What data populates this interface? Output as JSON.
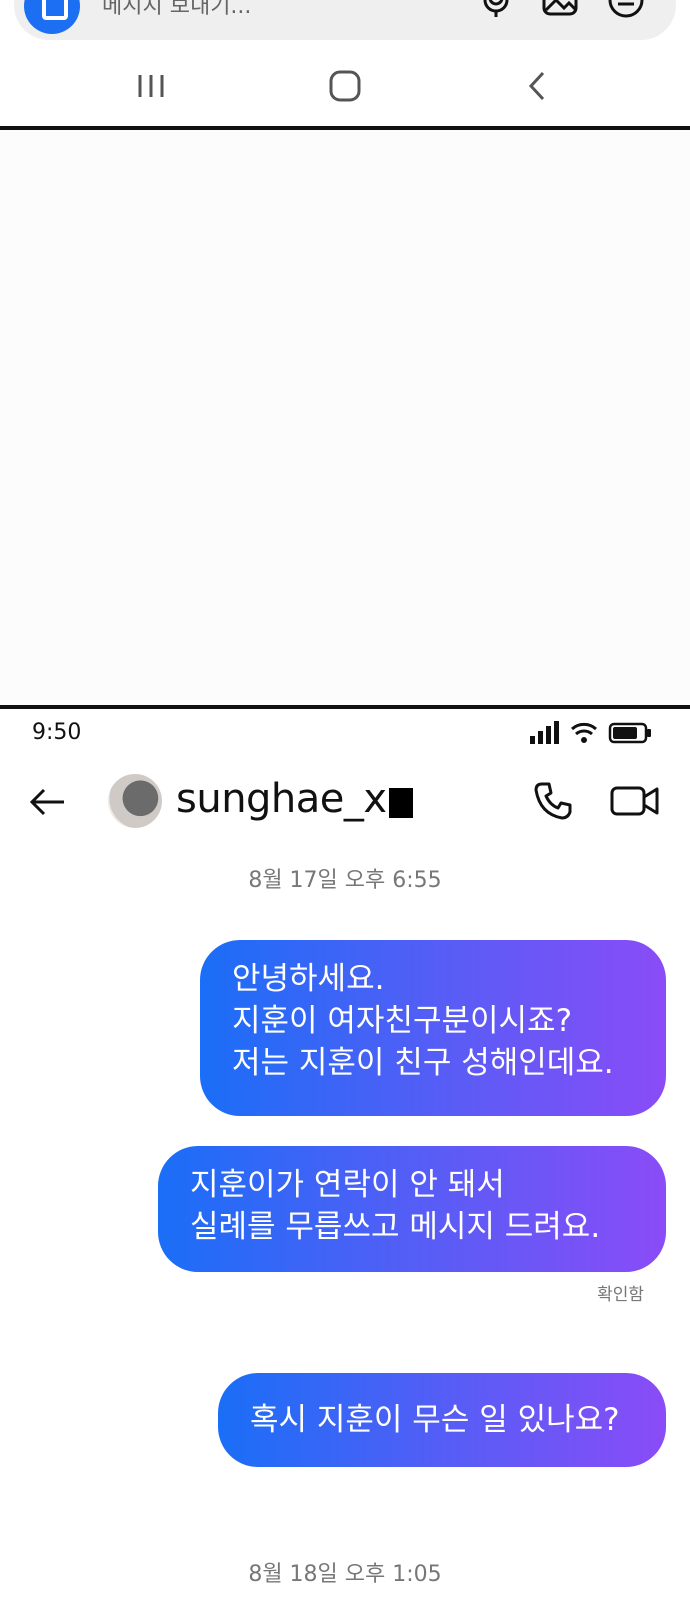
{
  "composer": {
    "placeholder": "메시지 보내기...",
    "icons": [
      "camera-icon",
      "microphone-icon",
      "gallery-icon",
      "sticker-icon"
    ]
  },
  "navbar": {
    "icons": [
      "recent-apps-icon",
      "home-icon",
      "back-icon"
    ]
  },
  "status": {
    "time": "9:50",
    "icons": [
      "signal-icon",
      "wifi-icon",
      "battery-icon"
    ]
  },
  "header": {
    "username": "sunghae_x",
    "icons": [
      "back-arrow-icon",
      "avatar",
      "phone-icon",
      "video-icon"
    ]
  },
  "messages": {
    "date1": "8월 17일 오후 6:55",
    "msg1": "안녕하세요.\n지훈이 여자친구분이시죠?\n저는 지훈이 친구 성해인데요.",
    "msg2": "지훈이가 연락이 안 돼서\n실례를 무릅쓰고 메시지 드려요.",
    "read_receipt": "확인함",
    "msg3": "혹시 지훈이 무슨 일 있나요?",
    "date2": "8월 18일 오후 1:05"
  },
  "colors": {
    "bubble_start": "#1a6ef7",
    "bubble_end": "#8a4cf7",
    "camera_button": "#1c6ef2"
  }
}
